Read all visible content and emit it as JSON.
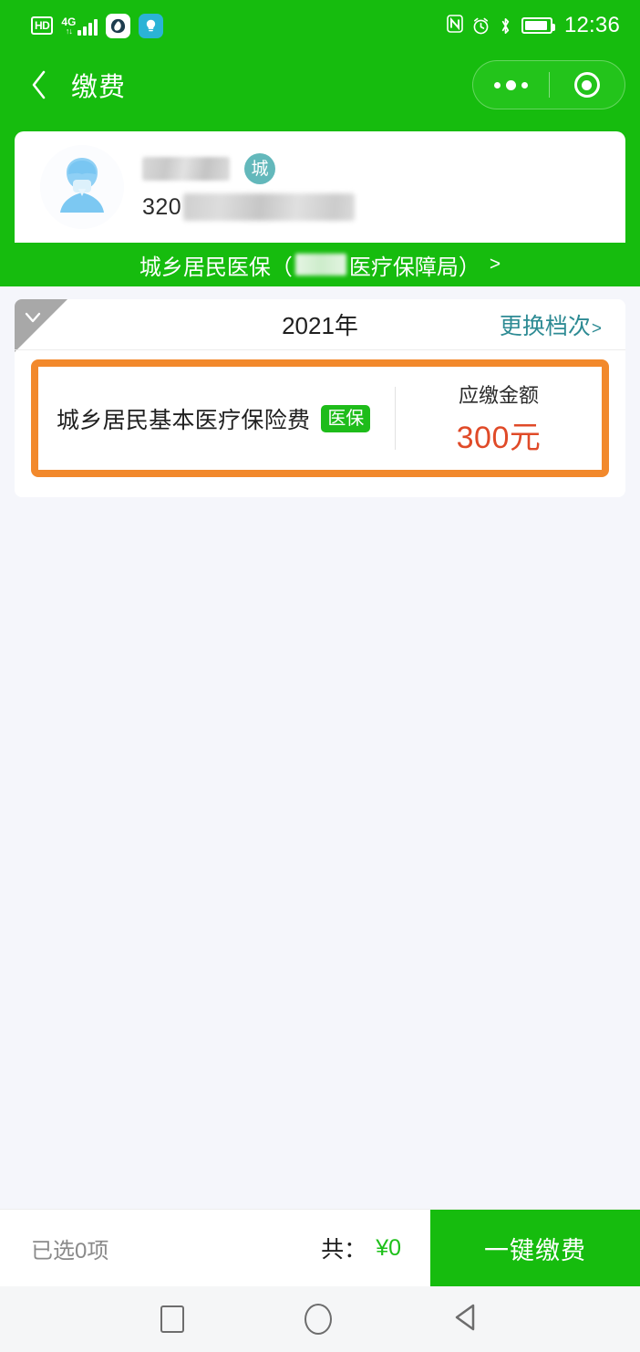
{
  "status_bar": {
    "hd_label": "HD",
    "network_gen": "4G",
    "network_arrows": "↑↓",
    "icons": [
      "hd-icon",
      "signal-icon",
      "browser-app-icon",
      "lightbulb-app-icon",
      "nfc-icon",
      "alarm-icon",
      "bluetooth-icon",
      "battery-icon"
    ],
    "time": "12:36"
  },
  "header": {
    "back_label": "‹",
    "title": "缴费",
    "capsule": {
      "more_label": "•••",
      "target_label": "◉"
    }
  },
  "profile": {
    "name_masked": "",
    "city_badge": "城",
    "id_prefix": "320",
    "id_masked": ""
  },
  "org_bar": {
    "prefix": "城乡居民医保（",
    "masked_region": "",
    "suffix": "医疗保障局）",
    "arrow": ">"
  },
  "fee_card": {
    "checked": true,
    "check_glyph": "✓",
    "year": "2021年",
    "change_tier_label": "更换档次",
    "change_tier_arrow": ">",
    "items": [
      {
        "name": "城乡居民基本医疗保险费",
        "badge": "医保",
        "amount_label": "应缴金额",
        "amount_value": "300元",
        "highlighted": true
      }
    ]
  },
  "bottom_bar": {
    "selected_text": "已选0项",
    "total_label": "共：",
    "total_amount": "¥0",
    "pay_button_label": "一键缴费"
  },
  "android_nav": {
    "recents": "recents-square-icon",
    "home": "home-circle-icon",
    "back": "back-triangle-icon"
  },
  "colors": {
    "brand_green": "#16bc0e",
    "accent_orange": "#f2892c",
    "amount_red": "#e04a28",
    "link_teal": "#2e8b94",
    "badge_teal": "#63b8bb",
    "page_bg": "#f5f6fb"
  }
}
